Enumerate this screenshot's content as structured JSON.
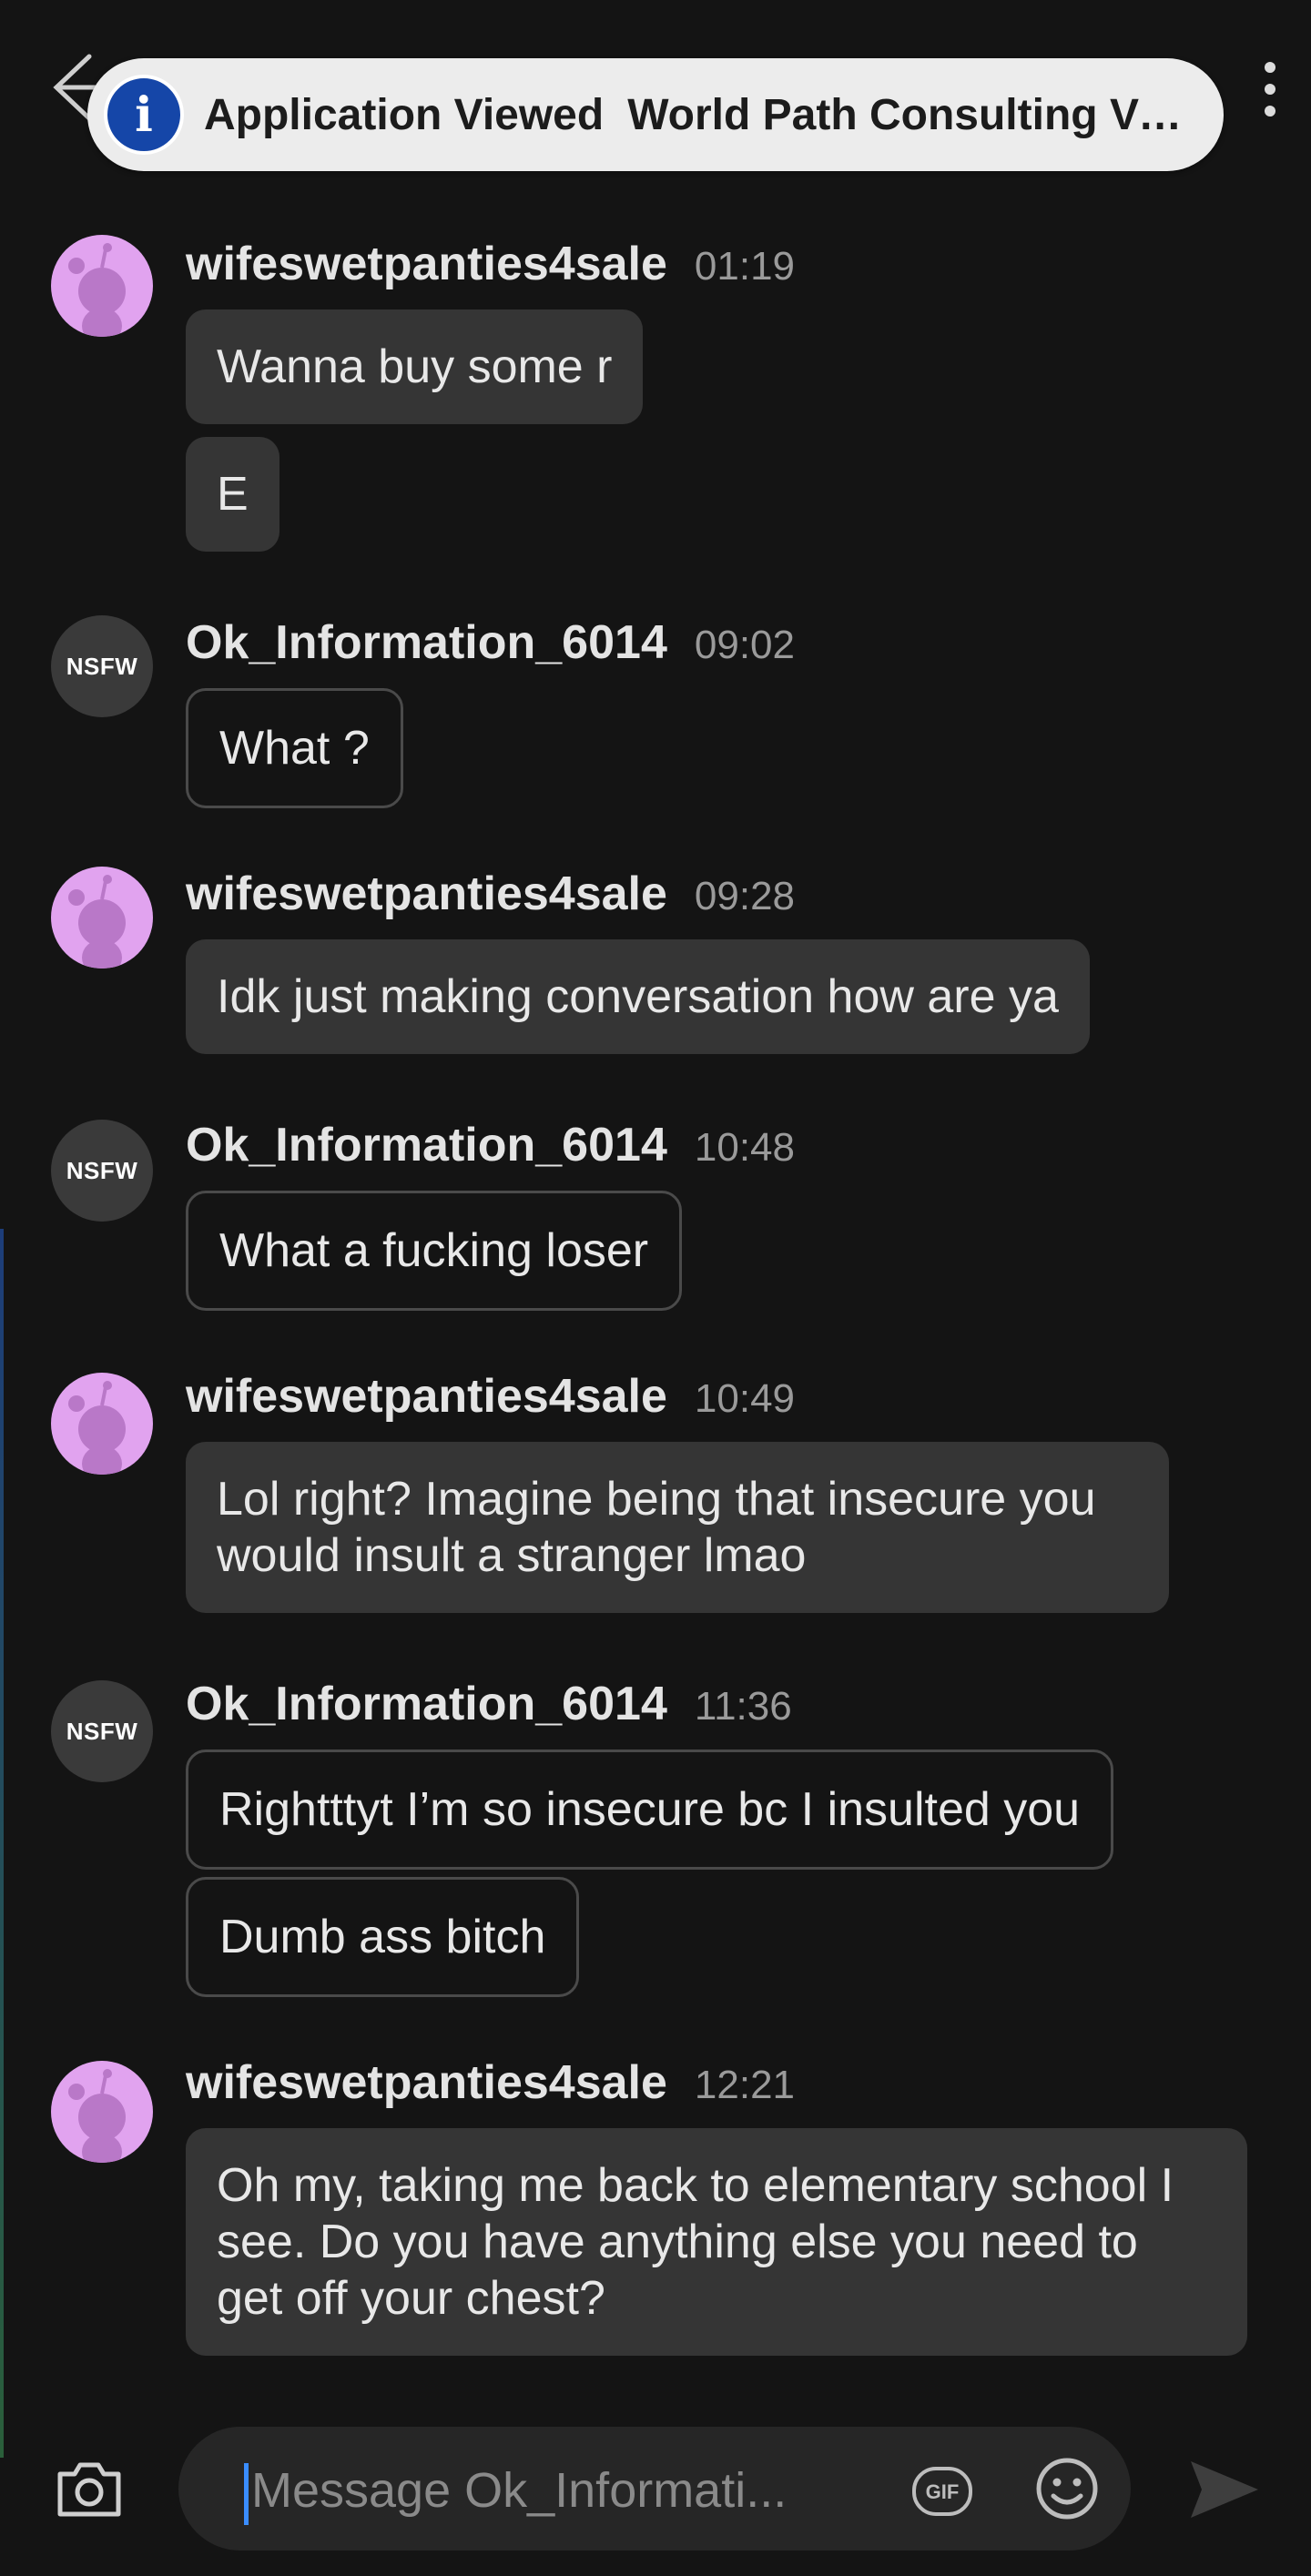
{
  "notification": {
    "title": "Application Viewed",
    "body": "World Path Consulting Vie…",
    "icon": "info-icon"
  },
  "icons": {
    "back": "back-arrow-icon",
    "more": "more-vertical-icon",
    "camera": "camera-icon",
    "gif": "gif-icon",
    "emoji": "emoji-icon",
    "send": "send-icon"
  },
  "colors": {
    "background": "#141414",
    "bubble": "#353535",
    "avatar_pink": "#e1a3ef",
    "notification_accent": "#1546a8",
    "caret": "#3a8dff"
  },
  "messages": [
    {
      "user": "wifeswetpanties4sale",
      "time": "01:19",
      "avatar": "snoo",
      "bubbles": [
        "Wanna buy some r",
        "E"
      ]
    },
    {
      "user": "Ok_Information_6014",
      "time": "09:02",
      "avatar": "nsfw",
      "avatar_label": "NSFW",
      "bubbles": [
        "What ?"
      ]
    },
    {
      "user": "wifeswetpanties4sale",
      "time": "09:28",
      "avatar": "snoo",
      "bubbles": [
        "Idk just making conversation how are ya"
      ]
    },
    {
      "user": "Ok_Information_6014",
      "time": "10:48",
      "avatar": "nsfw",
      "avatar_label": "NSFW",
      "bubbles": [
        "What a fucking loser"
      ]
    },
    {
      "user": "wifeswetpanties4sale",
      "time": "10:49",
      "avatar": "snoo",
      "bubbles": [
        "Lol right? Imagine being that insecure you would insult a stranger lmao"
      ]
    },
    {
      "user": "Ok_Information_6014",
      "time": "11:36",
      "avatar": "nsfw",
      "avatar_label": "NSFW",
      "bubbles": [
        "Rightttyt I’m so insecure bc I insulted you",
        "Dumb ass bitch"
      ]
    },
    {
      "user": "wifeswetpanties4sale",
      "time": "12:21",
      "avatar": "snoo",
      "bubbles": [
        "Oh my, taking me back to elementary school I see. Do you have anything else you need to get off your chest?"
      ]
    }
  ],
  "composer": {
    "placeholder": "Message Ok_Informati..."
  }
}
